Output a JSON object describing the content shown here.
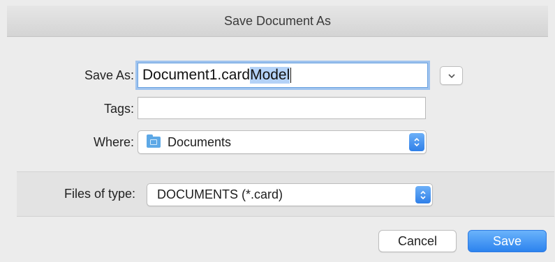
{
  "window": {
    "title": "Save Document As"
  },
  "save_as": {
    "label": "Save As:",
    "value_prefix": "Document1.card",
    "value_selected": "Model"
  },
  "tags": {
    "label": "Tags:",
    "value": ""
  },
  "where": {
    "label": "Where:",
    "value": "Documents",
    "icon": "folder-icon"
  },
  "file_type": {
    "label": "Files of type:",
    "value": "DOCUMENTS (*.card)"
  },
  "buttons": {
    "cancel": "Cancel",
    "save": "Save"
  },
  "colors": {
    "accent": "#2f7fe8",
    "selection": "#b4d2f7",
    "focus_ring": "#9fc3ee"
  }
}
